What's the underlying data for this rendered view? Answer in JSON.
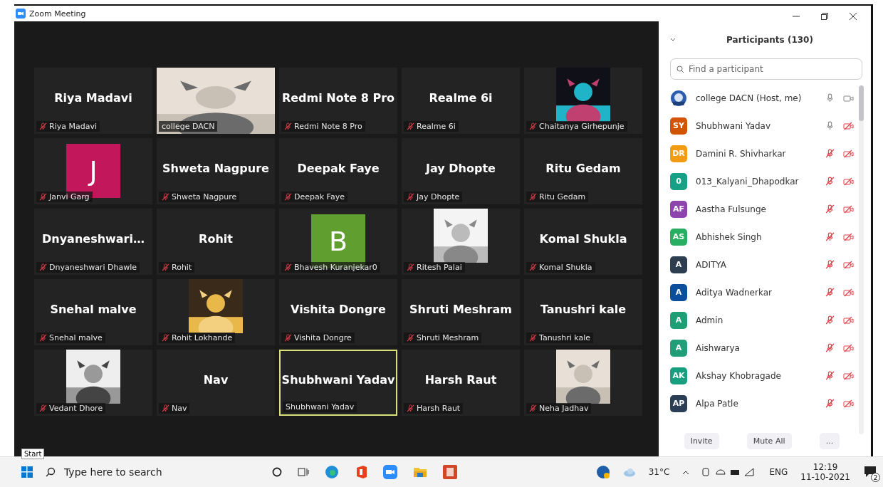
{
  "window": {
    "title": "Zoom Meeting"
  },
  "tiles": [
    {
      "kind": "name",
      "title": "Riya Madavi",
      "label": "Riya Madavi",
      "muted": true,
      "active": false
    },
    {
      "kind": "video",
      "label": "college DACN",
      "muted": false,
      "active": false
    },
    {
      "kind": "name",
      "title": "Redmi Note 8 Pro",
      "label": "Redmi Note 8 Pro",
      "muted": true,
      "active": false
    },
    {
      "kind": "name",
      "title": "Realme 6i",
      "label": "Realme 6i",
      "muted": true,
      "active": false
    },
    {
      "kind": "picture",
      "label": "Chaitanya Girhepunje",
      "muted": true,
      "active": false
    },
    {
      "kind": "avatar",
      "letter": "J",
      "color": "#c2185b",
      "label": "Janvi Garg",
      "muted": true,
      "active": false
    },
    {
      "kind": "name",
      "title": "Shweta Nagpure",
      "label": "Shweta Nagpure",
      "muted": true,
      "active": false
    },
    {
      "kind": "name",
      "title": "Deepak Faye",
      "label": "Deepak Faye",
      "muted": true,
      "active": false
    },
    {
      "kind": "name",
      "title": "Jay Dhopte",
      "label": "Jay Dhopte",
      "muted": true,
      "active": false
    },
    {
      "kind": "name",
      "title": "Ritu Gedam",
      "label": "Ritu Gedam",
      "muted": true,
      "active": false
    },
    {
      "kind": "name",
      "title": "Dnyaneshwari…",
      "label": "Dnyaneshwari Dhawle",
      "muted": true,
      "active": false
    },
    {
      "kind": "name",
      "title": "Rohit",
      "label": "Rohit",
      "muted": true,
      "active": false
    },
    {
      "kind": "avatar",
      "letter": "B",
      "color": "#5f9e2f",
      "label": "Bhavesh Kuranjekar0",
      "muted": true,
      "active": false
    },
    {
      "kind": "picture",
      "label": "Ritesh Palai",
      "muted": true,
      "active": false
    },
    {
      "kind": "name",
      "title": "Komal Shukla",
      "label": "Komal Shukla",
      "muted": true,
      "active": false
    },
    {
      "kind": "name",
      "title": "Snehal malve",
      "label": "Snehal malve",
      "muted": true,
      "active": false
    },
    {
      "kind": "picture",
      "label": "Rohit Lokhande",
      "muted": true,
      "active": false
    },
    {
      "kind": "name",
      "title": "Vishita Dongre",
      "label": "Vishita Dongre",
      "muted": true,
      "active": false
    },
    {
      "kind": "name",
      "title": "Shruti Meshram",
      "label": "Shruti Meshram",
      "muted": true,
      "active": false
    },
    {
      "kind": "name",
      "title": "Tanushri kale",
      "label": "Tanushri kale",
      "muted": true,
      "active": false
    },
    {
      "kind": "picture",
      "label": "Vedant Dhore",
      "muted": true,
      "active": false
    },
    {
      "kind": "name",
      "title": "Nav",
      "label": "Nav",
      "muted": true,
      "active": false
    },
    {
      "kind": "name",
      "title": "Shubhwani Yadav",
      "label": "Shubhwani Yadav",
      "muted": false,
      "active": true
    },
    {
      "kind": "name",
      "title": "Harsh Raut",
      "label": "Harsh Raut",
      "muted": true,
      "active": false
    },
    {
      "kind": "picture",
      "label": "Neha Jadhav",
      "muted": true,
      "active": false
    }
  ],
  "tooltip": "Start",
  "participants_panel": {
    "title": "Participants (130)",
    "search": {
      "placeholder": "Find a participant"
    },
    "participants": [
      {
        "kind": "picture",
        "name": "college DACN (Host, me)",
        "mic_muted": false,
        "video_off": false
      },
      {
        "kind": "initials",
        "initials": "SY",
        "color": "#d35400",
        "name": "Shubhwani Yadav",
        "mic_muted": false,
        "video_off": true
      },
      {
        "kind": "initials",
        "initials": "DR",
        "color": "#f39c12",
        "name": "Damini R. Shivharkar",
        "mic_muted": true,
        "video_off": true
      },
      {
        "kind": "initials",
        "initials": "0",
        "color": "#16a085",
        "name": "013_Kalyani_Dhapodkar",
        "mic_muted": true,
        "video_off": true
      },
      {
        "kind": "initials",
        "initials": "AF",
        "color": "#8e44ad",
        "name": "Aastha Fulsunge",
        "mic_muted": true,
        "video_off": true
      },
      {
        "kind": "initials",
        "initials": "AS",
        "color": "#27ae60",
        "name": "Abhishek Singh",
        "mic_muted": true,
        "video_off": true
      },
      {
        "kind": "initials",
        "initials": "A",
        "color": "#2c3e50",
        "name": "ADITYA",
        "mic_muted": true,
        "video_off": true
      },
      {
        "kind": "initials",
        "initials": "A",
        "color": "#0b4f9c",
        "name": "Aditya Wadnerkar",
        "mic_muted": true,
        "video_off": true
      },
      {
        "kind": "initials",
        "initials": "A",
        "color": "#1e9e74",
        "name": "Admin",
        "mic_muted": true,
        "video_off": true
      },
      {
        "kind": "initials",
        "initials": "A",
        "color": "#1f9e78",
        "name": "Aishwarya",
        "mic_muted": true,
        "video_off": true
      },
      {
        "kind": "initials",
        "initials": "AK",
        "color": "#17a080",
        "name": "Akshay Khobragade",
        "mic_muted": true,
        "video_off": true
      },
      {
        "kind": "initials",
        "initials": "AP",
        "color": "#2c3e55",
        "name": "Alpa Patle",
        "mic_muted": true,
        "video_off": true
      }
    ],
    "buttons": [
      "Invite",
      "Mute All",
      "..."
    ]
  },
  "taskbar": {
    "search_placeholder": "Type here to search",
    "temperature": "31°C",
    "language": "ENG",
    "time": "12:19",
    "date": "11-10-2021",
    "notifications": "2"
  }
}
